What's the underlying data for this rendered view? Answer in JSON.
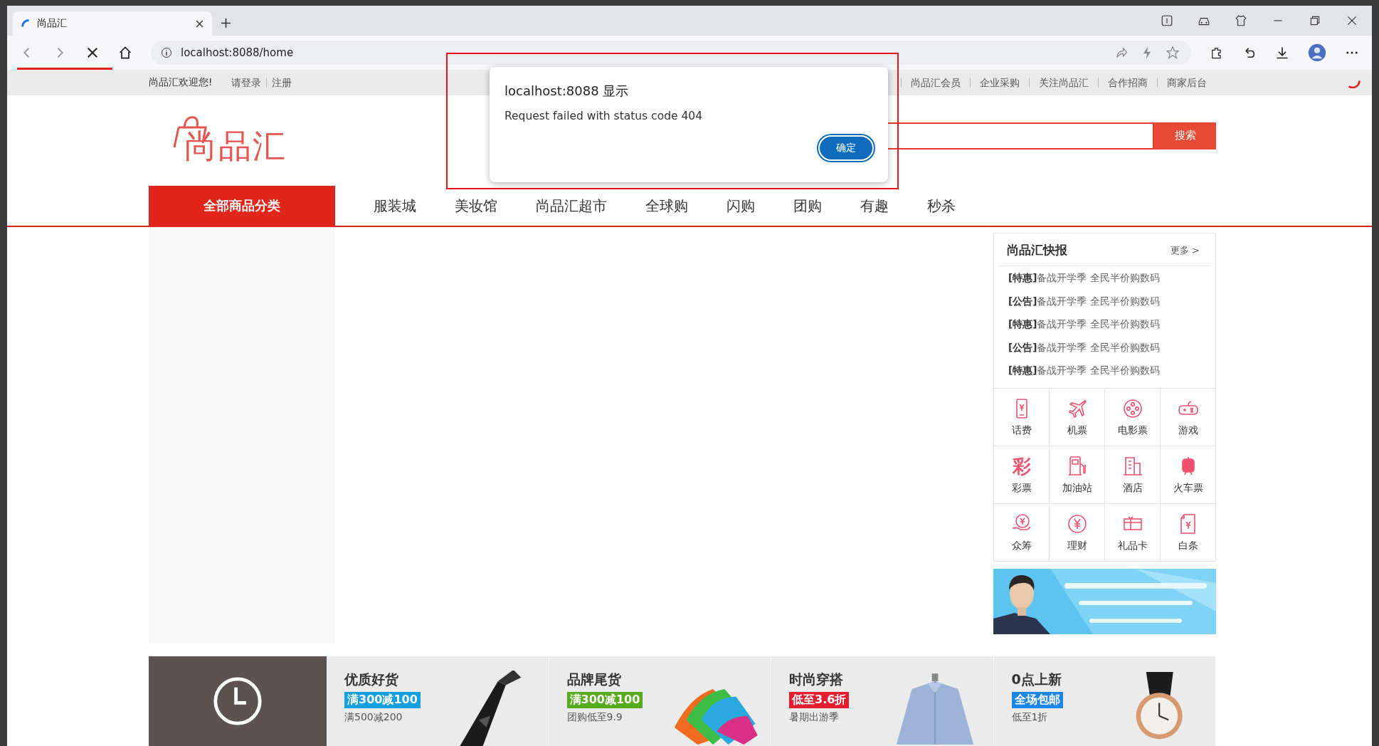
{
  "browser": {
    "tab": {
      "title": "尚品汇",
      "loading": true
    },
    "url": "localhost:8088/home"
  },
  "topbar": {
    "welcome": "尚品汇欢迎您!",
    "login": "请登录",
    "register": "注册",
    "links": [
      "尚品汇会员",
      "企业采购",
      "关注尚品汇",
      "合作招商",
      "商家后台"
    ]
  },
  "logo": "尚品汇",
  "search": {
    "button": "搜索"
  },
  "nav": {
    "all": "全部商品分类",
    "items": [
      "服装城",
      "美妆馆",
      "尚品汇超市",
      "全球购",
      "闪购",
      "团购",
      "有趣",
      "秒杀"
    ]
  },
  "dialog": {
    "title": "localhost:8088 显示",
    "message": "Request failed with status code 404",
    "button": "确定"
  },
  "news": {
    "title": "尚品汇快报",
    "more": "更多 >",
    "items": [
      {
        "tag": "[特惠]",
        "text": "备战开学季 全民半价购数码"
      },
      {
        "tag": "[公告]",
        "text": "备战开学季 全民半价购数码"
      },
      {
        "tag": "[特惠]",
        "text": "备战开学季 全民半价购数码"
      },
      {
        "tag": "[公告]",
        "text": "备战开学季 全民半价购数码"
      },
      {
        "tag": "[特惠]",
        "text": "备战开学季 全民半价购数码"
      }
    ]
  },
  "services": [
    {
      "label": "话费",
      "kind": "phone"
    },
    {
      "label": "机票",
      "kind": "plane"
    },
    {
      "label": "电影票",
      "kind": "film"
    },
    {
      "label": "游戏",
      "kind": "game"
    },
    {
      "label": "彩票",
      "kind": "glyph",
      "glyph": "彩"
    },
    {
      "label": "加油站",
      "kind": "fuel"
    },
    {
      "label": "酒店",
      "kind": "hotel"
    },
    {
      "label": "火车票",
      "kind": "train"
    },
    {
      "label": "众筹",
      "kind": "fund"
    },
    {
      "label": "理财",
      "kind": "coin"
    },
    {
      "label": "礼品卡",
      "kind": "gift"
    },
    {
      "label": "白条",
      "kind": "bill"
    }
  ],
  "promos": [
    {
      "title": "优质好货",
      "badge": "满300减100",
      "color": "#12a0e0",
      "note": "满500减200",
      "kind": "vacuum"
    },
    {
      "title": "品牌尾货",
      "badge": "满300减100",
      "color": "#56ab1c",
      "note": "团购低至9.9",
      "kind": "towels"
    },
    {
      "title": "时尚穿搭",
      "badge": "低至3.6折",
      "color": "#e41e2e",
      "note": "暑期出游季",
      "kind": "shirt"
    },
    {
      "title": "0点上新",
      "badge": "全场包邮",
      "color": "#1a86e8",
      "note": "低至1折",
      "kind": "watch"
    }
  ]
}
